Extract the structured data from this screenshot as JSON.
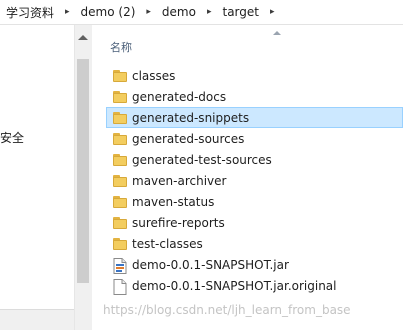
{
  "breadcrumb": {
    "items": [
      "学习资料",
      "demo (2)",
      "demo",
      "target"
    ],
    "separator": "▸"
  },
  "nav": {
    "security_label": "安全"
  },
  "content": {
    "column_header": "名称",
    "files": [
      {
        "name": "classes",
        "type": "folder"
      },
      {
        "name": "generated-docs",
        "type": "folder"
      },
      {
        "name": "generated-snippets",
        "type": "folder",
        "selected": true
      },
      {
        "name": "generated-sources",
        "type": "folder"
      },
      {
        "name": "generated-test-sources",
        "type": "folder"
      },
      {
        "name": "maven-archiver",
        "type": "folder"
      },
      {
        "name": "maven-status",
        "type": "folder"
      },
      {
        "name": "surefire-reports",
        "type": "folder"
      },
      {
        "name": "test-classes",
        "type": "folder"
      },
      {
        "name": "demo-0.0.1-SNAPSHOT.jar",
        "type": "jar"
      },
      {
        "name": "demo-0.0.1-SNAPSHOT.jar.original",
        "type": "file"
      }
    ]
  },
  "watermark": "https://blog.csdn.net/ljh_learn_from_base",
  "colors": {
    "selection_bg": "#cce8ff",
    "selection_border": "#99d1ff",
    "folder": "#f3cd5f",
    "header_text": "#4c607a"
  }
}
